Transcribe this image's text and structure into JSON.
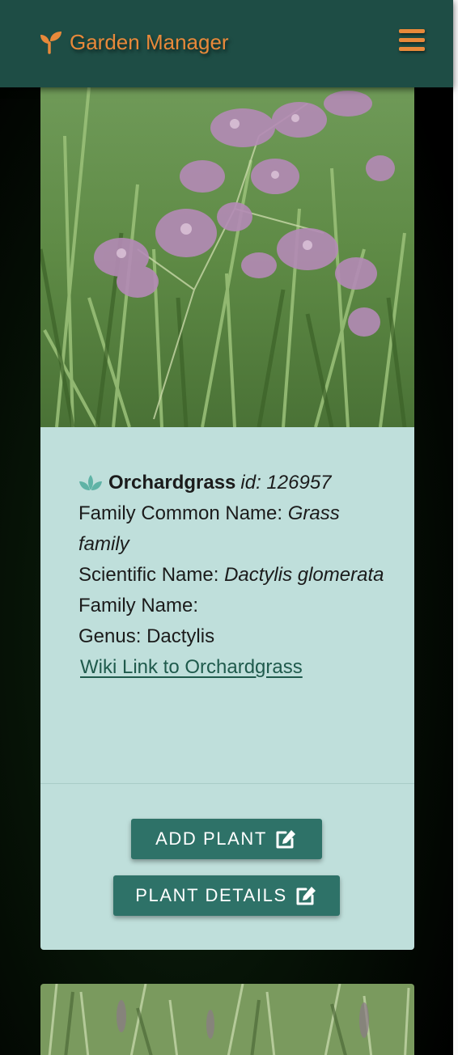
{
  "navbar": {
    "brand_name": "Garden Manager",
    "brand_icon": "seedling-icon",
    "menu_icon": "hamburger-menu-icon",
    "accent_color": "#e8893a",
    "background_color": "#1e4d45"
  },
  "plant_card": {
    "image_icon": "plant-photo",
    "type_icon": "spa-lotus-icon",
    "common_name": "Orchardgrass",
    "id_label": "id: 126957",
    "family_common_name_label": "Family Common Name:",
    "family_common_name_value": "Grass family",
    "scientific_name_label": "Scientific Name:",
    "scientific_name_value": "Dactylis glomerata",
    "family_name_label": "Family Name:",
    "family_name_value": "",
    "genus_label": "Genus:",
    "genus_value": "Dactylis",
    "wiki_link_text": "Wiki Link to Orchardgrass",
    "add_plant_label": "ADD PLANT",
    "plant_details_label": "PLANT DETAILS",
    "button_icon": "edit-icon",
    "card_color": "#bfdfdb",
    "button_color": "#2e7268"
  }
}
